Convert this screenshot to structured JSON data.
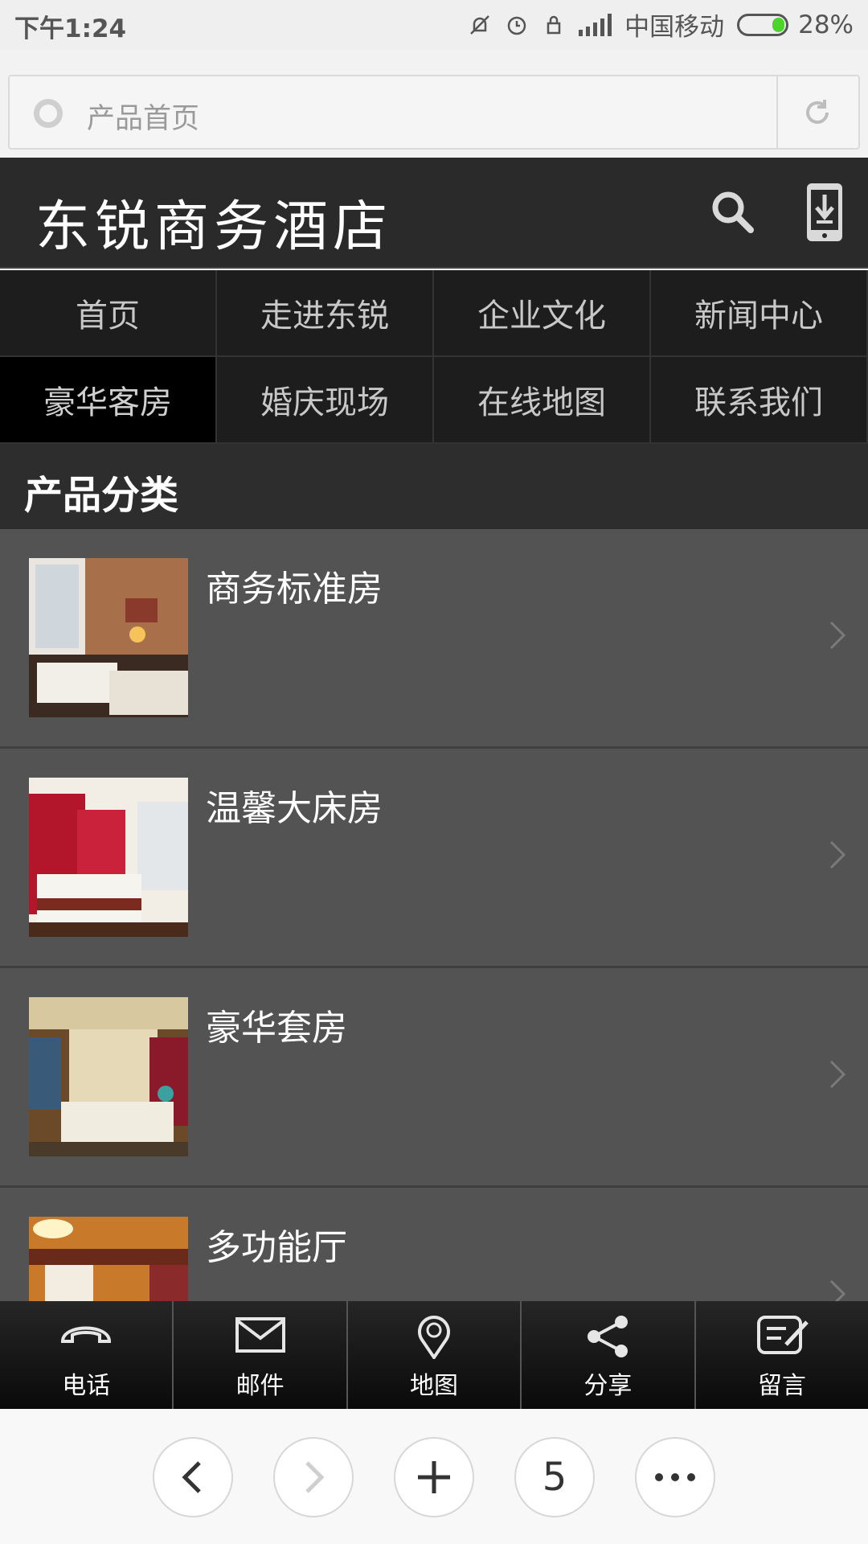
{
  "status_bar": {
    "time": "下午1:24",
    "carrier": "中国移动",
    "battery": "28%",
    "battery_level": 0.28
  },
  "address_bar": {
    "title": "产品首页"
  },
  "header": {
    "site_title": "东锐商务酒店"
  },
  "nav": {
    "items": [
      "首页",
      "走进东锐",
      "企业文化",
      "新闻中心",
      "豪华客房",
      "婚庆现场",
      "在线地图",
      "联系我们"
    ],
    "active_index": 4
  },
  "section": {
    "title": "产品分类"
  },
  "products": [
    {
      "name": "商务标准房"
    },
    {
      "name": "温馨大床房"
    },
    {
      "name": "豪华套房"
    },
    {
      "name": "多功能厅"
    }
  ],
  "toolbar": {
    "items": [
      {
        "label": "电话",
        "icon": "phone-icon"
      },
      {
        "label": "邮件",
        "icon": "mail-icon"
      },
      {
        "label": "地图",
        "icon": "map-pin-icon"
      },
      {
        "label": "分享",
        "icon": "share-icon"
      },
      {
        "label": "留言",
        "icon": "message-icon"
      }
    ]
  },
  "browser_nav": {
    "tab_count": "5"
  },
  "colors": {
    "header_bg": "#2a2a2a",
    "nav_active_bg": "#000000",
    "list_bg": "#535353",
    "battery_fill": "#4bd52a"
  }
}
